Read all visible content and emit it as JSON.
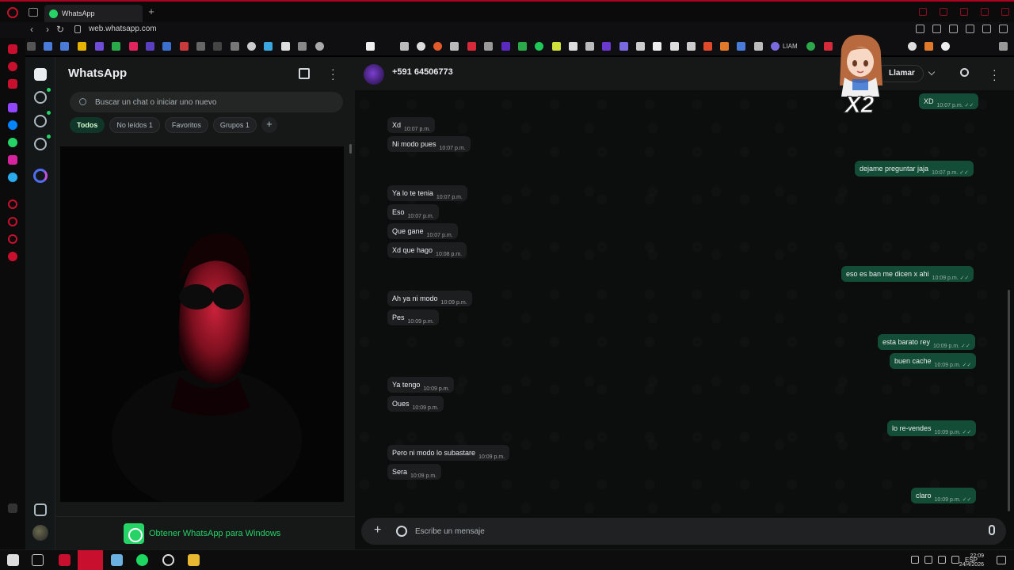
{
  "browser": {
    "tab_title": "WhatsApp",
    "url": "web.whatsapp.com",
    "bookmark_label": "LIAM"
  },
  "sidebar": {
    "app_title": "WhatsApp",
    "search_placeholder": "Buscar un chat o iniciar uno nuevo",
    "filters": [
      {
        "label": "Todos"
      },
      {
        "label": "No leídos 1"
      },
      {
        "label": "Favoritos"
      },
      {
        "label": "Grupos 1"
      }
    ],
    "get_app_label": "Obtener WhatsApp para Windows"
  },
  "conversation": {
    "contact": "+591 64506773",
    "call_label": "Llamar",
    "composer_placeholder": "Escribe un mensaje",
    "messages": [
      {
        "dir": "out",
        "text": "XD",
        "time": "10:07 p.m."
      },
      {
        "dir": "in",
        "text": "Xd",
        "time": "10:07 p.m."
      },
      {
        "dir": "in",
        "text": "Ni modo pues",
        "time": "10:07 p.m."
      },
      {
        "dir": "out",
        "text": "dejame preguntar jaja",
        "time": "10:07 p.m."
      },
      {
        "dir": "in",
        "text": "Ya lo te tenia",
        "time": "10:07 p.m."
      },
      {
        "dir": "in",
        "text": "Eso",
        "time": "10:07 p.m."
      },
      {
        "dir": "in",
        "text": "Que gane",
        "time": "10:07 p.m."
      },
      {
        "dir": "in",
        "text": "Xd que hago",
        "time": "10:08 p.m."
      },
      {
        "dir": "out",
        "text": "eso es ban me dicen x ahi",
        "time": "10:09 p.m."
      },
      {
        "dir": "in",
        "text": "Ah ya ni modo",
        "time": "10:09 p.m."
      },
      {
        "dir": "in",
        "text": "Pes",
        "time": "10:09 p.m."
      },
      {
        "dir": "out",
        "text": "esta barato rey",
        "time": "10:09 p.m."
      },
      {
        "dir": "out",
        "text": "buen cache",
        "time": "10:09 p.m."
      },
      {
        "dir": "in",
        "text": "Ya tengo",
        "time": "10:09 p.m."
      },
      {
        "dir": "in",
        "text": "Oues",
        "time": "10:09 p.m."
      },
      {
        "dir": "out",
        "text": "lo re-vendes",
        "time": "10:09 p.m."
      },
      {
        "dir": "in",
        "text": "Pero ni modo lo subastare",
        "time": "10:09 p.m."
      },
      {
        "dir": "in",
        "text": "Sera",
        "time": "10:09 p.m."
      },
      {
        "dir": "out",
        "text": "claro",
        "time": "10:09 p.m."
      }
    ]
  },
  "sticker": {
    "text": "X2"
  },
  "taskbar": {
    "language": "ESP",
    "time": "22:09",
    "date": "24/4/2026"
  },
  "colors": {
    "accent": "#25d366",
    "outgoing_bubble": "#144d37",
    "incoming_bubble": "#1c1e1f",
    "browser_accent": "#c8102e"
  }
}
